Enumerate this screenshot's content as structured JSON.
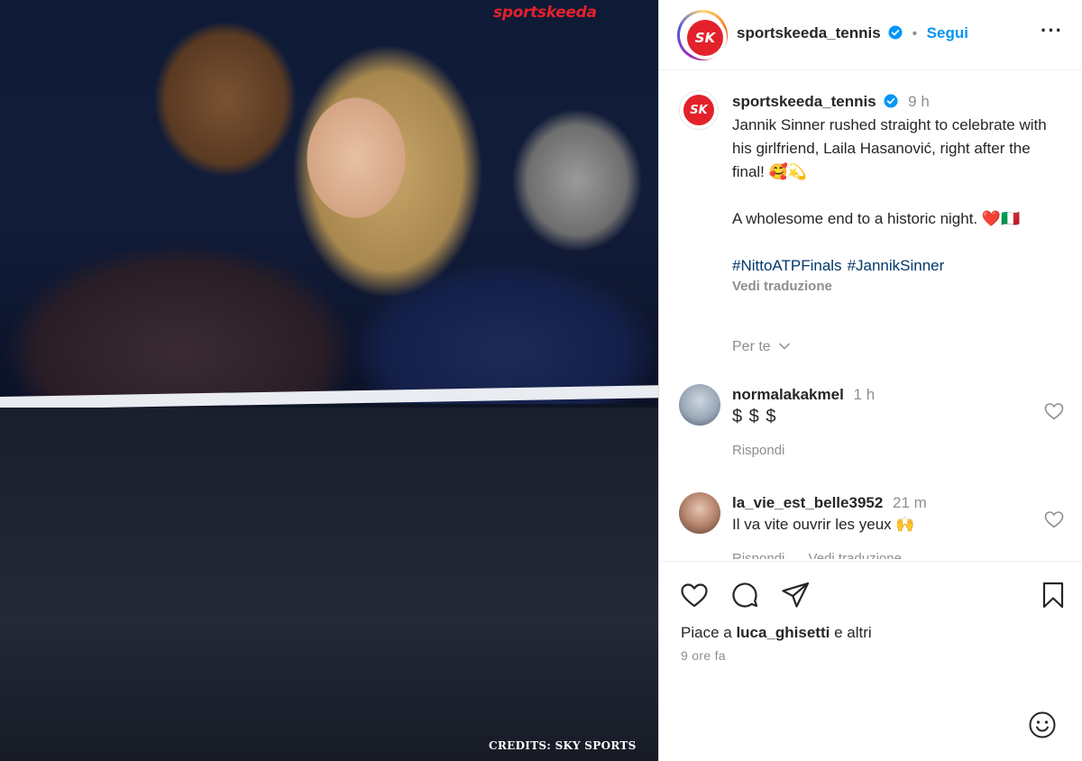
{
  "media": {
    "watermark": "sportskeeda",
    "credits": "CREDITS: SKY SPORTS"
  },
  "header": {
    "username": "sportskeeda_tennis",
    "separator": "•",
    "follow_label": "Segui",
    "more_icon": "more-icon",
    "avatar_text": "SK"
  },
  "caption": {
    "username": "sportskeeda_tennis",
    "time": "9 h",
    "line1": "Jannik Sinner rushed straight to celebrate with his girlfriend, Laila Hasanović, right after the final! 🥰💫",
    "line2": "A wholesome end to a historic night. ❤️🇮🇹",
    "hashtags": [
      "#NittoATPFinals",
      "#JannikSinner"
    ],
    "see_translation": "Vedi traduzione",
    "for_you": "Per te"
  },
  "comments": [
    {
      "username": "normalakakmel",
      "time": "1 h",
      "text": "$ $ $",
      "actions": [
        "Rispondi"
      ]
    },
    {
      "username": "la_vie_est_belle3952",
      "time": "21 m",
      "text": "Il va vite ouvrir les yeux 🙌",
      "actions": [
        "Rispondi",
        "Vedi traduzione"
      ]
    }
  ],
  "actions": {
    "likes_prefix": "Piace a",
    "likes_user": "luca_ghisetti",
    "likes_suffix": "e altri",
    "time_ago": "9 ore fa",
    "add_comment_placeholder": ""
  },
  "colors": {
    "accent": "#0095f6",
    "brand_red": "#e3212b",
    "secondary_text": "#8e8e8e",
    "hashtag": "#00376b"
  }
}
